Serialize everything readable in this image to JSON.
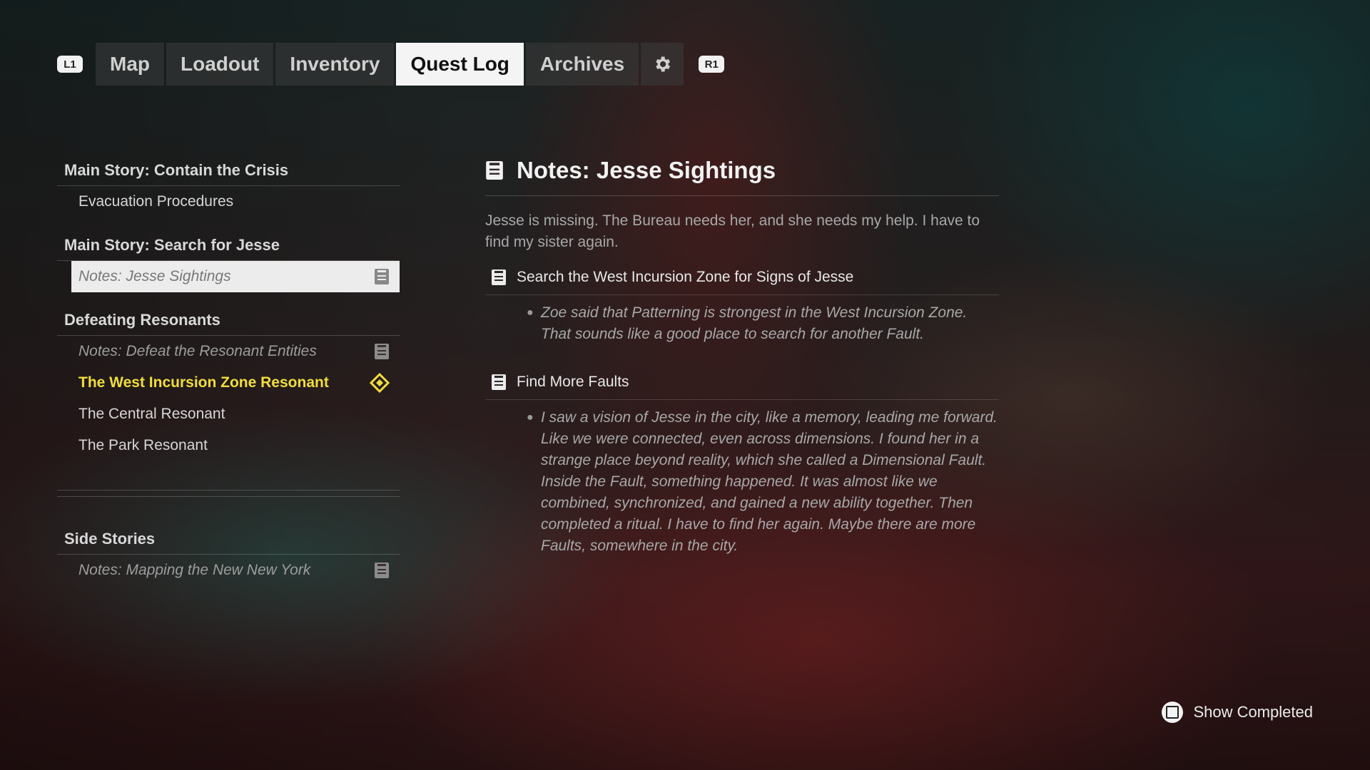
{
  "tabbar": {
    "left_bumper": "L1",
    "right_bumper": "R1",
    "tabs": [
      {
        "label": "Map"
      },
      {
        "label": "Loadout"
      },
      {
        "label": "Inventory"
      },
      {
        "label": "Quest Log",
        "active": true
      },
      {
        "label": "Archives"
      }
    ],
    "settings_icon": "gear-icon"
  },
  "quest_groups": [
    {
      "title": "Main Story: Contain the Crisis",
      "items": [
        {
          "label": "Evacuation Procedures"
        }
      ]
    },
    {
      "title": "Main Story: Search for Jesse",
      "items": [
        {
          "label": "Notes: Jesse Sightings",
          "note": true,
          "selected": true
        }
      ]
    },
    {
      "title": "Defeating Resonants",
      "items": [
        {
          "label": "Notes: Defeat the Resonant Entities",
          "note": true
        },
        {
          "label": "The West Incursion Zone Resonant",
          "tracked": true
        },
        {
          "label": "The Central Resonant"
        },
        {
          "label": "The Park Resonant"
        }
      ]
    },
    {
      "title": "Side Stories",
      "items": [
        {
          "label": "Notes: Mapping the New New York",
          "note": true
        }
      ]
    }
  ],
  "detail": {
    "title": "Notes: Jesse Sightings",
    "description": "Jesse is missing. The Bureau needs her, and she needs my help. I have to find my sister again.",
    "objectives": [
      {
        "title": "Search the West Incursion Zone for Signs of Jesse",
        "text": "Zoe said that Patterning is strongest in the West Incursion Zone. That sounds like a good place to search for another Fault."
      },
      {
        "title": "Find More Faults",
        "text": "I saw a vision of Jesse in the city, like a memory, leading me forward. Like we were connected, even across dimensions. I found her in a strange place beyond reality, which she called a Dimensional Fault. Inside the Fault, something happened. It was almost like we combined, synchronized, and gained a new ability together. Then completed a ritual. I have to find her again. Maybe there are more Faults, somewhere in the city."
      }
    ]
  },
  "footer": {
    "show_completed_label": "Show Completed",
    "button_icon": "square-button-icon"
  },
  "colors": {
    "tracked": "#f0de3a",
    "active_tab_bg": "#f4f4f4"
  }
}
